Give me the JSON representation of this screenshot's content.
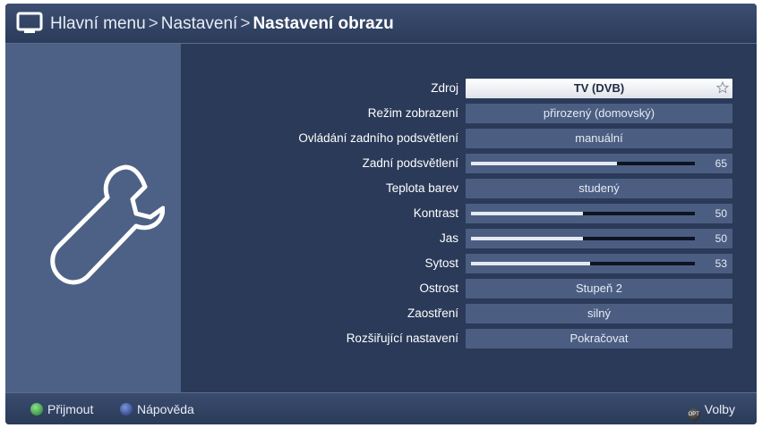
{
  "header": {
    "icon": "tv-icon",
    "breadcrumb": [
      "Hlavní menu",
      "Nastavení",
      "Nastavení obrazu"
    ],
    "separator": ">"
  },
  "sidebar": {
    "icon": "wrench-icon"
  },
  "settings": [
    {
      "label": "Zdroj",
      "type": "select",
      "value": "TV (DVB)",
      "selected": true,
      "icon": "star-icon"
    },
    {
      "label": "Režim zobrazení",
      "type": "select",
      "value": "přirozený (domovský)"
    },
    {
      "label": "Ovládání zadního podsvětlení",
      "type": "select",
      "value": "manuální"
    },
    {
      "label": "Zadní podsvětlení",
      "type": "slider",
      "value": 65,
      "display": "65"
    },
    {
      "label": "Teplota barev",
      "type": "select",
      "value": "studený"
    },
    {
      "label": "Kontrast",
      "type": "slider",
      "value": 50,
      "display": "50"
    },
    {
      "label": "Jas",
      "type": "slider",
      "value": 50,
      "display": "50"
    },
    {
      "label": "Sytost",
      "type": "slider",
      "value": 53,
      "display": "53"
    },
    {
      "label": "Ostrost",
      "type": "select",
      "value": "Stupeň 2"
    },
    {
      "label": "Zaostření",
      "type": "select",
      "value": "silný"
    },
    {
      "label": "Rozšiřující nastavení",
      "type": "select",
      "value": "Pokračovat"
    }
  ],
  "footer": {
    "accept": {
      "label": "Přijmout",
      "color": "#2e9a3a",
      "icon": "green-button-icon"
    },
    "help": {
      "label": "Nápověda",
      "color": "#2a47a8",
      "icon": "blue-button-icon"
    },
    "options": {
      "label": "Volby",
      "badge": "OPT",
      "icon": "opt-button-icon"
    }
  },
  "colors": {
    "background": "#2a3a58",
    "sidebar": "#4d6186",
    "field": "#4b5e82",
    "selected_field": "#ffffff"
  }
}
